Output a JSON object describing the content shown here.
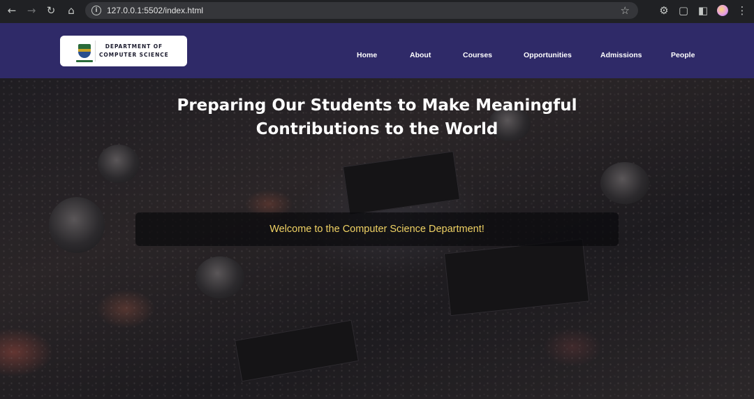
{
  "browser": {
    "url": "127.0.0.1:5502/index.html",
    "back_icon": "arrow-left-icon",
    "forward_icon": "arrow-right-icon",
    "reload_icon": "reload-icon",
    "home_icon": "home-icon"
  },
  "header": {
    "logo": {
      "line1": "DEPARTMENT OF",
      "line2": "COMPUTER SCIENCE"
    },
    "nav": [
      "Home",
      "About",
      "Courses",
      "Opportunities",
      "Admissions",
      "People"
    ],
    "background_color": "#2f2a68"
  },
  "hero": {
    "title_line1": "Preparing Our Students to Make Meaningful",
    "title_line2": "Contributions to the World",
    "welcome": "Welcome to the Computer Science Department!",
    "welcome_color": "#f0d264"
  }
}
